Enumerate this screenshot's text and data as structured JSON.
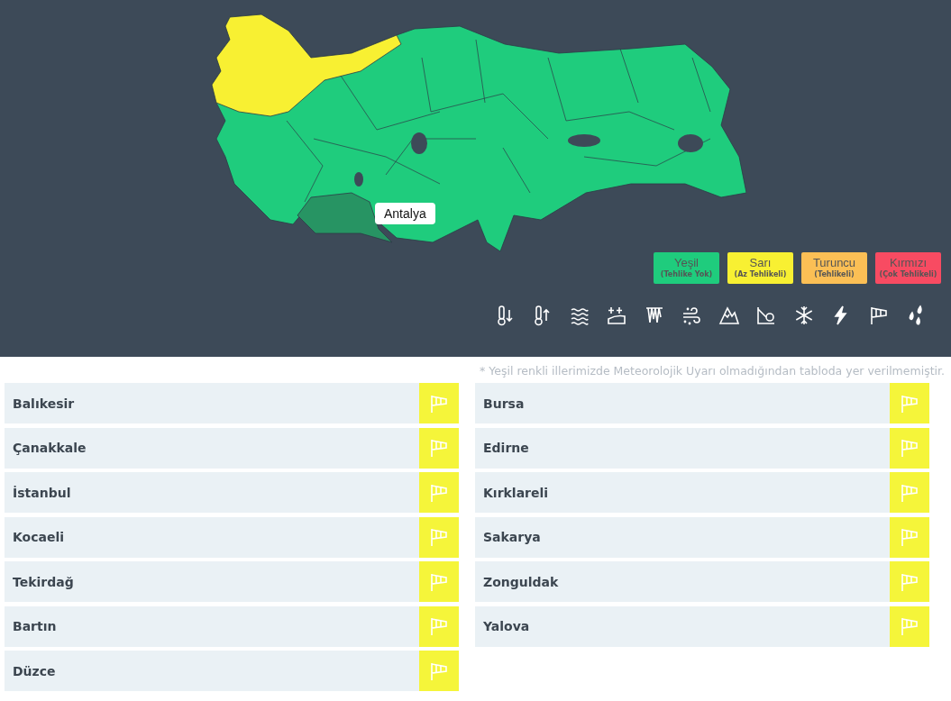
{
  "map": {
    "tooltip": "Antalya"
  },
  "legend": [
    {
      "label": "Yeşil",
      "sublabel": "(Tehlike Yok)",
      "color": "#1fcc7d"
    },
    {
      "label": "Sarı",
      "sublabel": "(Az Tehlikeli)",
      "color": "#f8f032"
    },
    {
      "label": "Turuncu",
      "sublabel": "(Tehlikeli)",
      "color": "#fbbf55"
    },
    {
      "label": "Kırmızı",
      "sublabel": "(Çok Tehlikeli)",
      "color": "#f84b62"
    }
  ],
  "note": "* Yeşil renkli illerimizde Meteorolojik Uyarı olmadığından tabloda yer verilmemiştir.",
  "columns": [
    [
      {
        "city": "Balıkesir",
        "color": "#f5f53a"
      },
      {
        "city": "Çanakkale",
        "color": "#f5f53a"
      },
      {
        "city": "İstanbul",
        "color": "#f5f53a"
      },
      {
        "city": "Kocaeli",
        "color": "#f5f53a"
      },
      {
        "city": "Tekirdağ",
        "color": "#f5f53a"
      },
      {
        "city": "Bartın",
        "color": "#f5f53a"
      },
      {
        "city": "Düzce",
        "color": "#f5f53a"
      }
    ],
    [
      {
        "city": "Bursa",
        "color": "#f5f53a"
      },
      {
        "city": "Edirne",
        "color": "#f5f53a"
      },
      {
        "city": "Kırklareli",
        "color": "#f5f53a"
      },
      {
        "city": "Sakarya",
        "color": "#f5f53a"
      },
      {
        "city": "Zonguldak",
        "color": "#f5f53a"
      },
      {
        "city": "Yalova",
        "color": "#f5f53a"
      }
    ]
  ]
}
